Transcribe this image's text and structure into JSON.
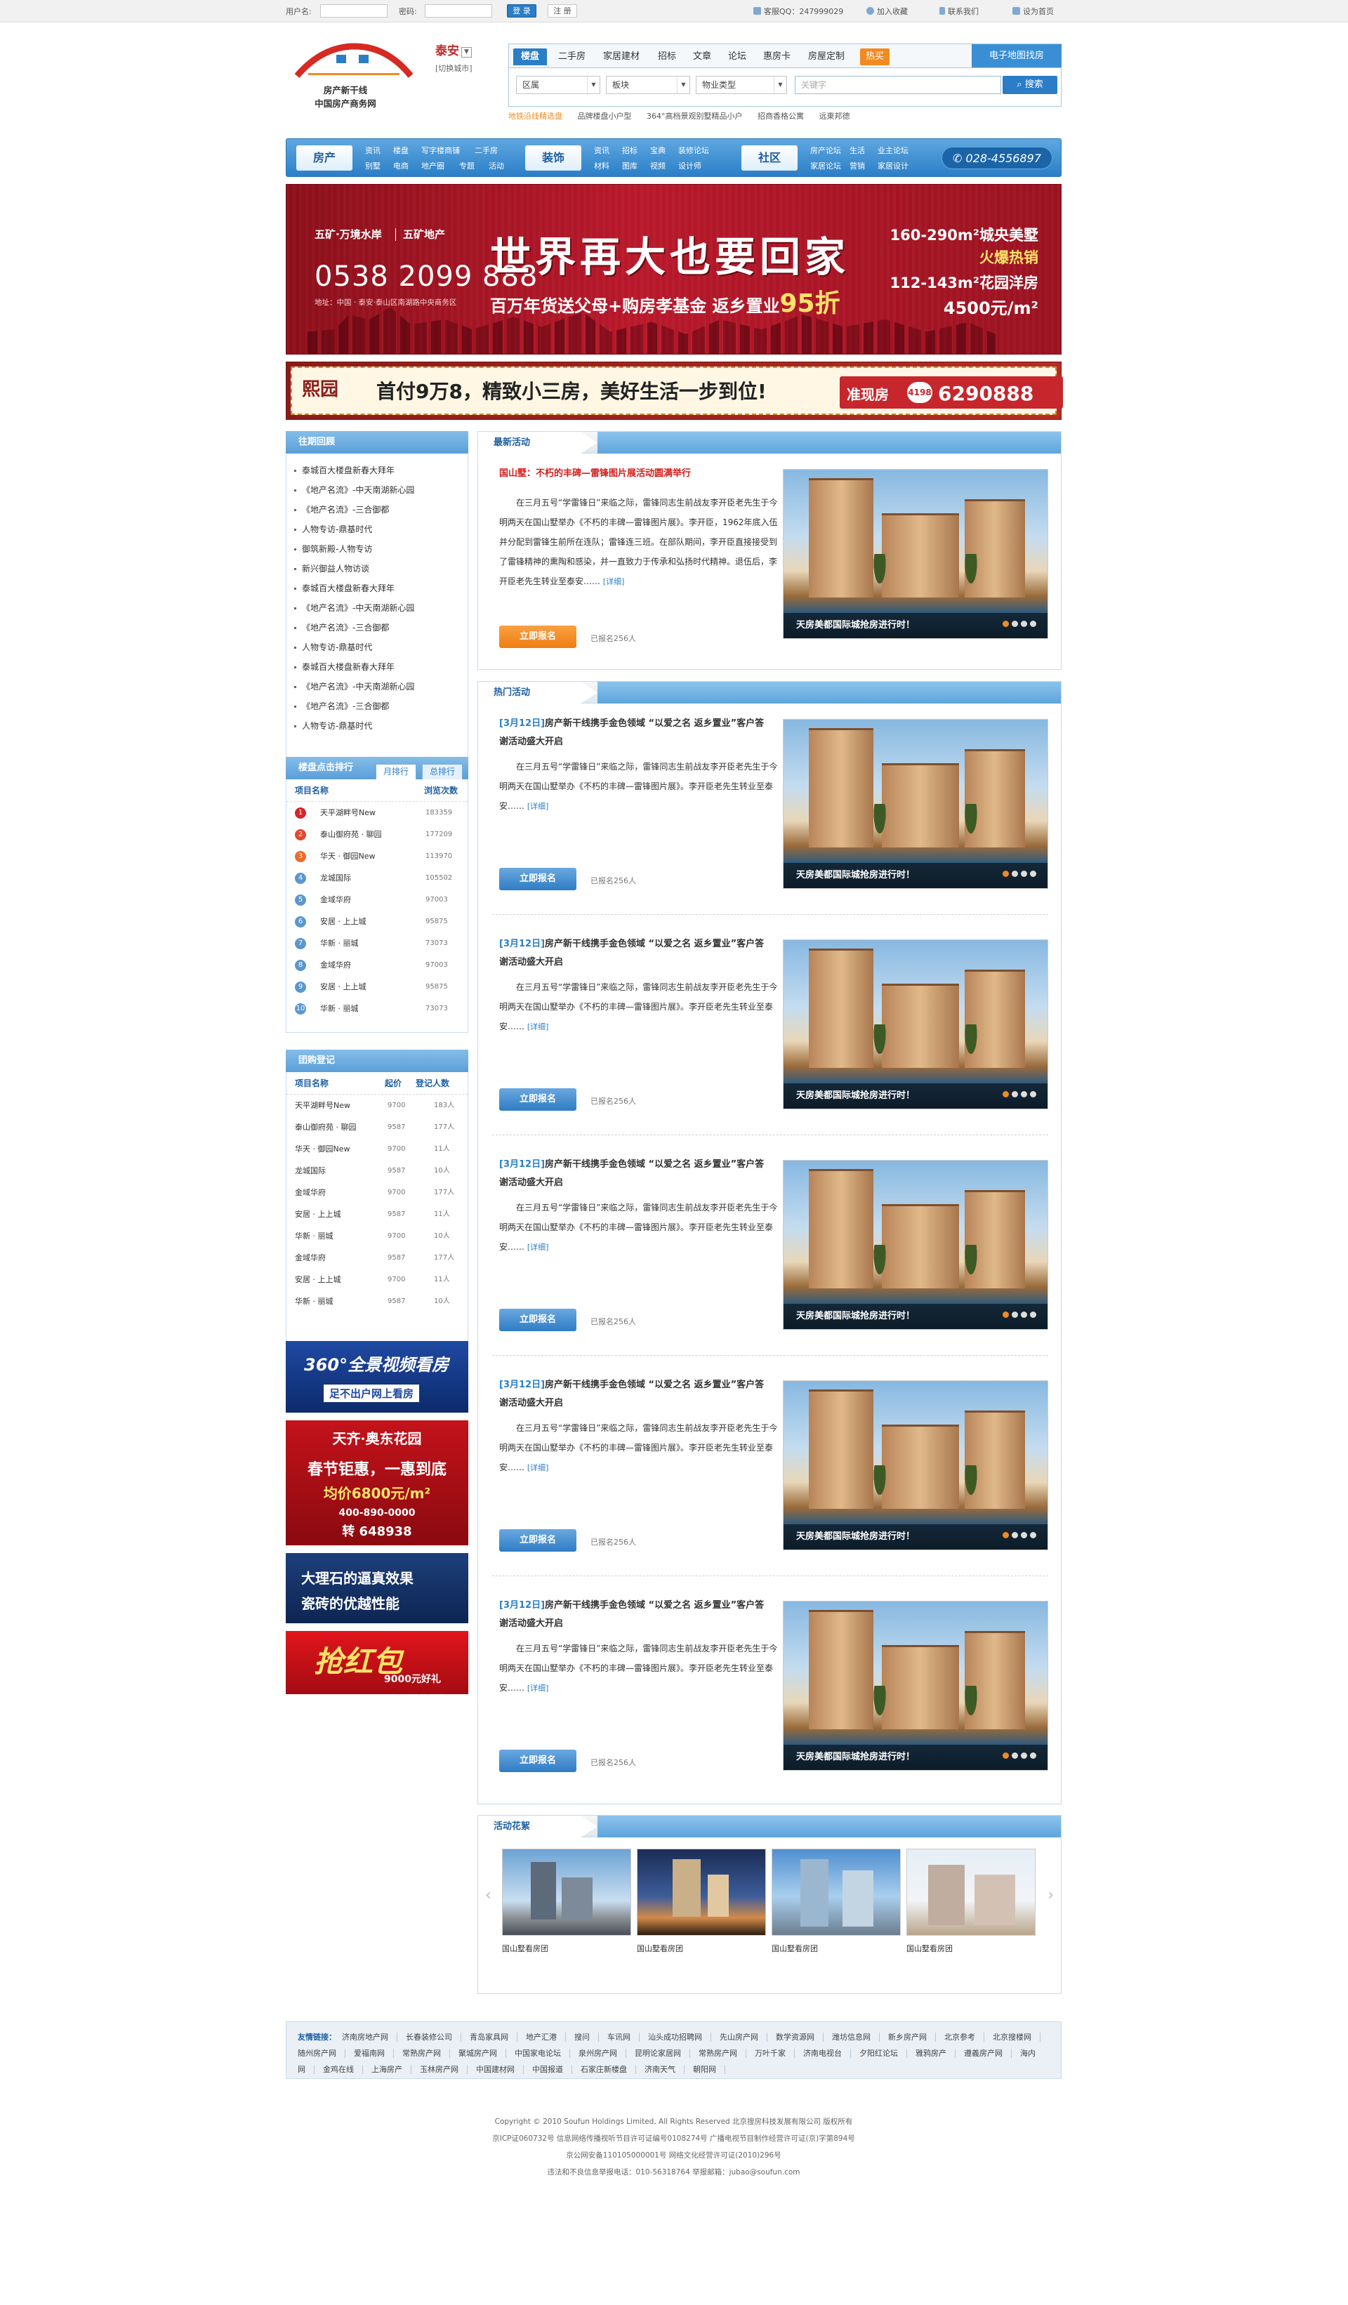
{
  "topbar": {
    "username_label": "用户名:",
    "password_label": "密码:",
    "login": "登 录",
    "register": "注 册",
    "service": "客服QQ：247999029",
    "favorite": "加入收藏",
    "contact": "联系我们",
    "homepage": "设为首页"
  },
  "logo": {
    "line1": "房产新干线",
    "line2": "中国房产商务网"
  },
  "city": {
    "name": "泰安",
    "switch": "[切换城市]"
  },
  "nav": {
    "tabs": [
      "楼盘",
      "二手房",
      "家居建材",
      "招标",
      "文章",
      "论坛",
      "惠房卡",
      "房屋定制"
    ],
    "hot": "热买",
    "map": "电子地图找房"
  },
  "search": {
    "selects": [
      "区属",
      "板块",
      "物业类型"
    ],
    "placeholder": "关键字",
    "button": "搜索",
    "hot_words": [
      "地铁沿线精选盘",
      "品牌楼盘小户型",
      "364°高档景观别墅精品小户",
      "招商香格公寓",
      "远東邦德"
    ]
  },
  "mainnav": {
    "house": {
      "title": "房产",
      "links": [
        "资讯",
        "楼盘",
        "写字楼商铺",
        "二手房",
        "别墅",
        "电商",
        "地产圈",
        "专题",
        "活动"
      ]
    },
    "decor": {
      "title": "装饰",
      "links": [
        "资讯",
        "招标",
        "宝典",
        "装修论坛",
        "材料",
        "图库",
        "视频",
        "设计师"
      ]
    },
    "community": {
      "title": "社区",
      "links": [
        "房产论坛",
        "生活",
        "业主论坛",
        "家居论坛",
        "营销",
        "家居设计"
      ]
    },
    "tel": "028-4556897"
  },
  "banner1": {
    "brand": "五矿·万境水岸",
    "brand2": "五矿地产",
    "tel": "0538 2099 888",
    "addr": "地址：中国 · 泰安·泰山区南湖路中央商务区",
    "headline": "世界再大也要回家",
    "sub": "百万年货送父母+购房孝基金 返乡置业",
    "sub_num": "95折",
    "r1": "160-290m²城央美墅",
    "r2": "火爆热销",
    "r3": "112-143m²花园洋房",
    "r4": "4500元/m²"
  },
  "banner2": {
    "logo": "熙园",
    "text": "首付9万8，精致小三房，美好生活一步到位!",
    "tag": "准现房",
    "badge": "4198",
    "tel": "6290888"
  },
  "review": {
    "title": "往期回顾",
    "items": [
      "泰城百大楼盘新春大拜年",
      "《地产名流》-中天南湖新心园",
      "《地产名流》-三合御都",
      "人物专访-鼎基时代",
      "御筑新殿-人物专访",
      "新兴御益人物访谈",
      "泰城百大楼盘新春大拜年",
      "《地产名流》-中天南湖新心园",
      "《地产名流》-三合御都",
      "人物专访-鼎基时代",
      "泰城百大楼盘新春大拜年",
      "《地产名流》-中天南湖新心园",
      "《地产名流》-三合御都",
      "人物专访-鼎基时代"
    ]
  },
  "rank": {
    "title": "楼盘点击排行",
    "tab_month": "月排行",
    "tab_total": "总排行",
    "col_name": "项目名称",
    "col_views": "浏览次数",
    "rows": [
      {
        "no": "1",
        "name": "天平湖畔号New",
        "v": "183359"
      },
      {
        "no": "2",
        "name": "泰山御府苑 · 聊园",
        "v": "177209"
      },
      {
        "no": "3",
        "name": "华天 · 御园New",
        "v": "113970"
      },
      {
        "no": "4",
        "name": "龙城国际",
        "v": "105502"
      },
      {
        "no": "5",
        "name": "金域华府",
        "v": "97003"
      },
      {
        "no": "6",
        "name": "安居 · 上上城",
        "v": "95875"
      },
      {
        "no": "7",
        "name": "华新 · 丽城",
        "v": "73073"
      },
      {
        "no": "8",
        "name": "金域华府",
        "v": "97003"
      },
      {
        "no": "9",
        "name": "安居 · 上上城",
        "v": "95875"
      },
      {
        "no": "10",
        "name": "华新 · 丽城",
        "v": "73073"
      }
    ]
  },
  "group": {
    "title": "团购登记",
    "col_name": "项目名称",
    "col_price": "起价",
    "col_count": "登记人数",
    "rows": [
      {
        "name": "天平湖畔号New",
        "p": "9700",
        "c": "183人"
      },
      {
        "name": "泰山御府苑 · 聊园",
        "p": "9587",
        "c": "177人"
      },
      {
        "name": "华天 · 御园New",
        "p": "9700",
        "c": "11人"
      },
      {
        "name": "龙城国际",
        "p": "9587",
        "c": "10人"
      },
      {
        "name": "金域华府",
        "p": "9700",
        "c": "177人"
      },
      {
        "name": "安居 · 上上城",
        "p": "9587",
        "c": "11人"
      },
      {
        "name": "华新 · 丽城",
        "p": "9700",
        "c": "10人"
      },
      {
        "name": "金域华府",
        "p": "9587",
        "c": "177人"
      },
      {
        "name": "安居 · 上上城",
        "p": "9700",
        "c": "11人"
      },
      {
        "name": "华新 · 丽城",
        "p": "9587",
        "c": "10人"
      }
    ]
  },
  "ads": {
    "a1_line1": "360°全景视频看房",
    "a1_line2": "足不出户网上看房",
    "a2_line1": "天齐·奥东花园",
    "a2_line2": "春节钜惠，一惠到底",
    "a2_line3": "均价6800元/m²",
    "a2_line4": "400-890-0000",
    "a2_line5": "转 648938",
    "a3_line1": "大理石的逼真效果",
    "a3_line2": "瓷砖的优越性能",
    "a4_line1": "抢红包",
    "a4_line2": "9000元好礼"
  },
  "latest": {
    "title": "最新活动",
    "item": {
      "title": "国山墅：不朽的丰碑—雷锋图片展活动圆满举行",
      "text": "在三月五号“学雷锋日”来临之际，雷锋同志生前战友李开臣老先生于今明两天在国山墅举办《不朽的丰碑—雷锋图片展》。李开臣，1962年底入伍并分配到雷锋生前所在连队；雷锋连三班。在部队期间，李开臣直接接受到了雷锋精神的熏陶和感染，并一直致力于传承和弘扬时代精神。退伍后，李开臣老先生转业至泰安……",
      "more": "[详细]",
      "join": "立即报名",
      "count": "已报名256人",
      "caption": "天房美都国际城抢房进行时！"
    }
  },
  "hot": {
    "title": "热门活动",
    "items": [
      {
        "date": "[3月12日]",
        "title": "房产新干线携手金色领域 “以爱之名 返乡置业”客户答谢活动盛大开启",
        "text": "在三月五号“学雷锋日”来临之际，雷锋同志生前战友李开臣老先生于今明两天在国山墅举办《不朽的丰碑—雷锋图片展》。李开臣老先生转业至泰安……",
        "more": "[详细]",
        "join": "立即报名",
        "count": "已报名256人",
        "caption": "天房美都国际城抢房进行时！"
      },
      {
        "date": "[3月12日]",
        "title": "房产新干线携手金色领域 “以爱之名 返乡置业”客户答谢活动盛大开启",
        "text": "在三月五号“学雷锋日”来临之际，雷锋同志生前战友李开臣老先生于今明两天在国山墅举办《不朽的丰碑—雷锋图片展》。李开臣老先生转业至泰安……",
        "more": "[详细]",
        "join": "立即报名",
        "count": "已报名256人",
        "caption": "天房美都国际城抢房进行时！"
      },
      {
        "date": "[3月12日]",
        "title": "房产新干线携手金色领域 “以爱之名 返乡置业”客户答谢活动盛大开启",
        "text": "在三月五号“学雷锋日”来临之际，雷锋同志生前战友李开臣老先生于今明两天在国山墅举办《不朽的丰碑—雷锋图片展》。李开臣老先生转业至泰安……",
        "more": "[详细]",
        "join": "立即报名",
        "count": "已报名256人",
        "caption": "天房美都国际城抢房进行时！"
      },
      {
        "date": "[3月12日]",
        "title": "房产新干线携手金色领域 “以爱之名 返乡置业”客户答谢活动盛大开启",
        "text": "在三月五号“学雷锋日”来临之际，雷锋同志生前战友李开臣老先生于今明两天在国山墅举办《不朽的丰碑—雷锋图片展》。李开臣老先生转业至泰安……",
        "more": "[详细]",
        "join": "立即报名",
        "count": "已报名256人",
        "caption": "天房美都国际城抢房进行时！"
      },
      {
        "date": "[3月12日]",
        "title": "房产新干线携手金色领域 “以爱之名 返乡置业”客户答谢活动盛大开启",
        "text": "在三月五号“学雷锋日”来临之际，雷锋同志生前战友李开臣老先生于今明两天在国山墅举办《不朽的丰碑—雷锋图片展》。李开臣老先生转业至泰安……",
        "more": "[详细]",
        "join": "立即报名",
        "count": "已报名256人",
        "caption": "天房美都国际城抢房进行时！"
      }
    ]
  },
  "gallery": {
    "title": "活动花絮",
    "items": [
      "国山墅看房团",
      "国山墅看房团",
      "国山墅看房团",
      "国山墅看房团"
    ]
  },
  "footer": {
    "links_title": "友情链接：",
    "links": [
      "济南房地产网",
      "长春装修公司",
      "青岛家具网",
      "地产汇港",
      "搜问",
      "车讯网",
      "汕头成功招聘网",
      "先山房产网",
      "数学资源网",
      "潍坊信息网",
      "新乡房产网",
      "北京参考",
      "北京搜楼网",
      "随州房产网",
      "爱福南网",
      "常熟房产网",
      "聚城房产网",
      "中国家电论坛",
      "泉州房产网",
      "昆明论家居网",
      "常熟房产网",
      "万叶千家",
      "济南电视台",
      "夕阳红论坛",
      "雅鸦房产",
      "遵義房产网",
      "海内网",
      "金鸡在线",
      "上海房产",
      "玉林房产网",
      "中国建材网",
      "中国报道",
      "石家庄新楼盘",
      "济南天气",
      "朝阳网"
    ],
    "copy1": "Copyright © 2010 Soufun Holdings Limited, All Rights Reserved 北京搜房科技发展有限公司 版权所有",
    "copy2": "京ICP证060732号  信息网络传播视听节目许可证编号0108274号  广播电视节目制作经营许可证(京)字第894号",
    "copy3": "京公网安备110105000001号 网络文化经营许可证(2010)296号",
    "copy4": "违法和不良信息举报电话：010-56318764  举报邮箱：jubao@soufun.com"
  }
}
